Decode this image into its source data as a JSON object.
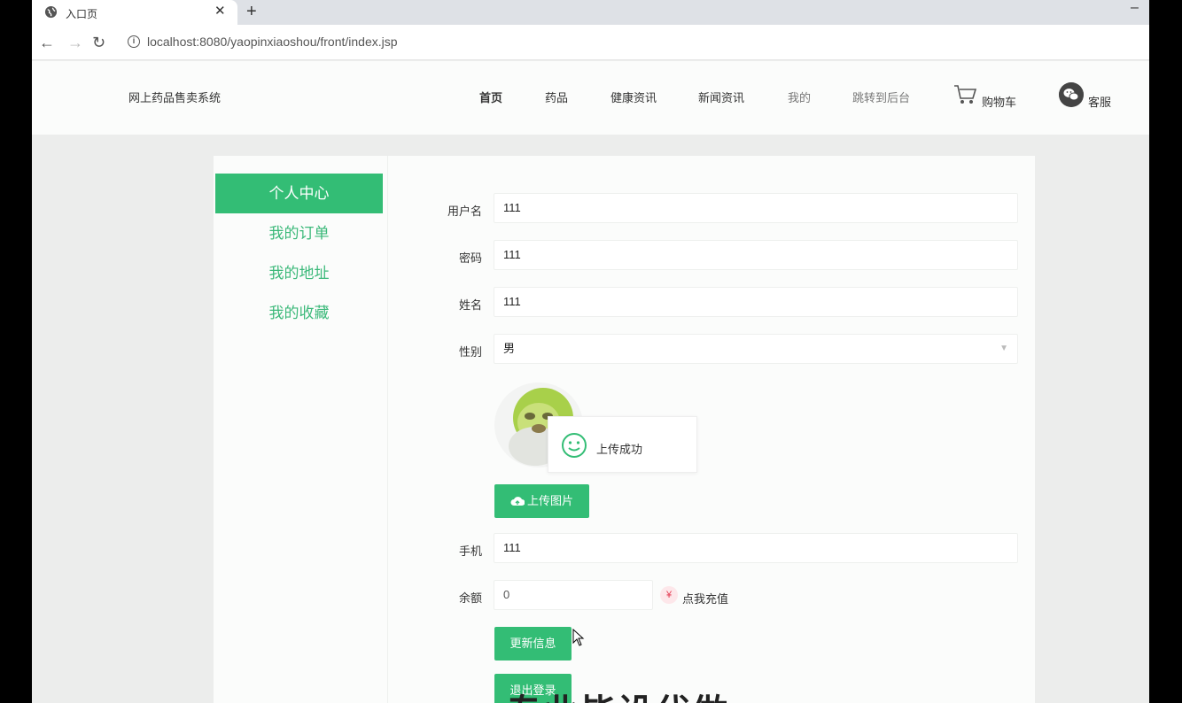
{
  "browser": {
    "tab_title": "入口页",
    "tab_close": "✕",
    "new_tab": "+",
    "minimize": "–",
    "url": "localhost:8080/yaopinxiaoshou/front/index.jsp",
    "back": "←",
    "forward": "→",
    "reload": "↻",
    "info": "i"
  },
  "header": {
    "site_title": "网上药品售卖系统",
    "nav": [
      {
        "label": "首页"
      },
      {
        "label": "药品"
      },
      {
        "label": "健康资讯"
      },
      {
        "label": "新闻资讯"
      },
      {
        "label": "我的"
      },
      {
        "label": "跳转到后台"
      }
    ],
    "cart_label": "购物车",
    "service_label": "客服",
    "cart_icon": "shopping-cart-icon",
    "service_icon": "wechat-icon"
  },
  "sidebar": {
    "items": [
      {
        "label": "个人中心"
      },
      {
        "label": "我的订单"
      },
      {
        "label": "我的地址"
      },
      {
        "label": "我的收藏"
      }
    ]
  },
  "form": {
    "username_label": "用户名",
    "username_value": "111",
    "password_label": "密码",
    "password_value": "111",
    "name_label": "姓名",
    "name_value": "111",
    "gender_label": "性别",
    "gender_value": "男",
    "upload_button": "上传图片",
    "toast_message": "上传成功",
    "phone_label": "手机",
    "phone_value": "111",
    "balance_label": "余额",
    "balance_value": "0",
    "recharge_icon": "¥",
    "recharge_text": "点我充值",
    "update_button": "更新信息",
    "logout_button": "退出登录"
  },
  "overlay": {
    "watermark": "专业毕设代做"
  },
  "colors": {
    "accent": "#33bd75",
    "accent_text": "#3cb97a",
    "recharge": "#e43b52"
  }
}
